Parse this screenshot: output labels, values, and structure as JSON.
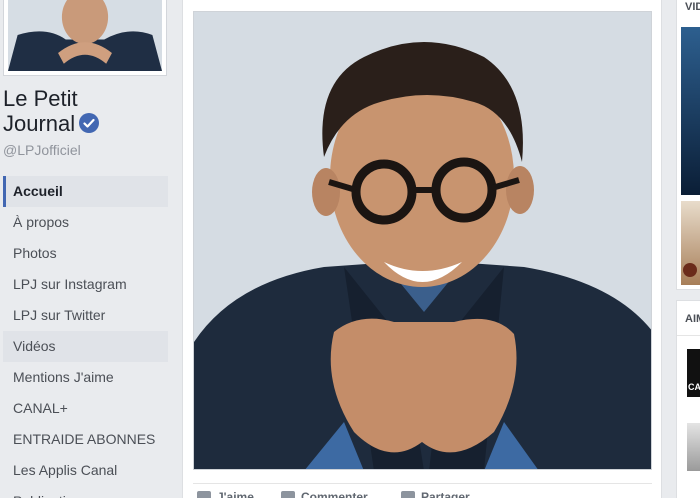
{
  "page": {
    "name_line1": "Le Petit",
    "name_line2": "Journal",
    "handle": "@LPJofficiel"
  },
  "nav": [
    {
      "label": "Accueil",
      "state": "active"
    },
    {
      "label": "À propos",
      "state": ""
    },
    {
      "label": "Photos",
      "state": ""
    },
    {
      "label": "LPJ sur Instagram",
      "state": ""
    },
    {
      "label": "LPJ sur Twitter",
      "state": ""
    },
    {
      "label": "Vidéos",
      "state": "hover"
    },
    {
      "label": "Mentions J'aime",
      "state": ""
    },
    {
      "label": "CANAL+",
      "state": ""
    },
    {
      "label": "ENTRAIDE ABONNES",
      "state": ""
    },
    {
      "label": "Les Applis Canal",
      "state": ""
    },
    {
      "label": "Publications",
      "state": ""
    }
  ],
  "post": {
    "actions": {
      "like": "J'aime",
      "comment": "Commenter",
      "share": "Partager"
    }
  },
  "right": {
    "videos_title": "VID",
    "likes_title": "AIM",
    "page1_abbrev": "CA"
  },
  "colors": {
    "accent": "#4267b2",
    "background": "#e9ebee"
  }
}
